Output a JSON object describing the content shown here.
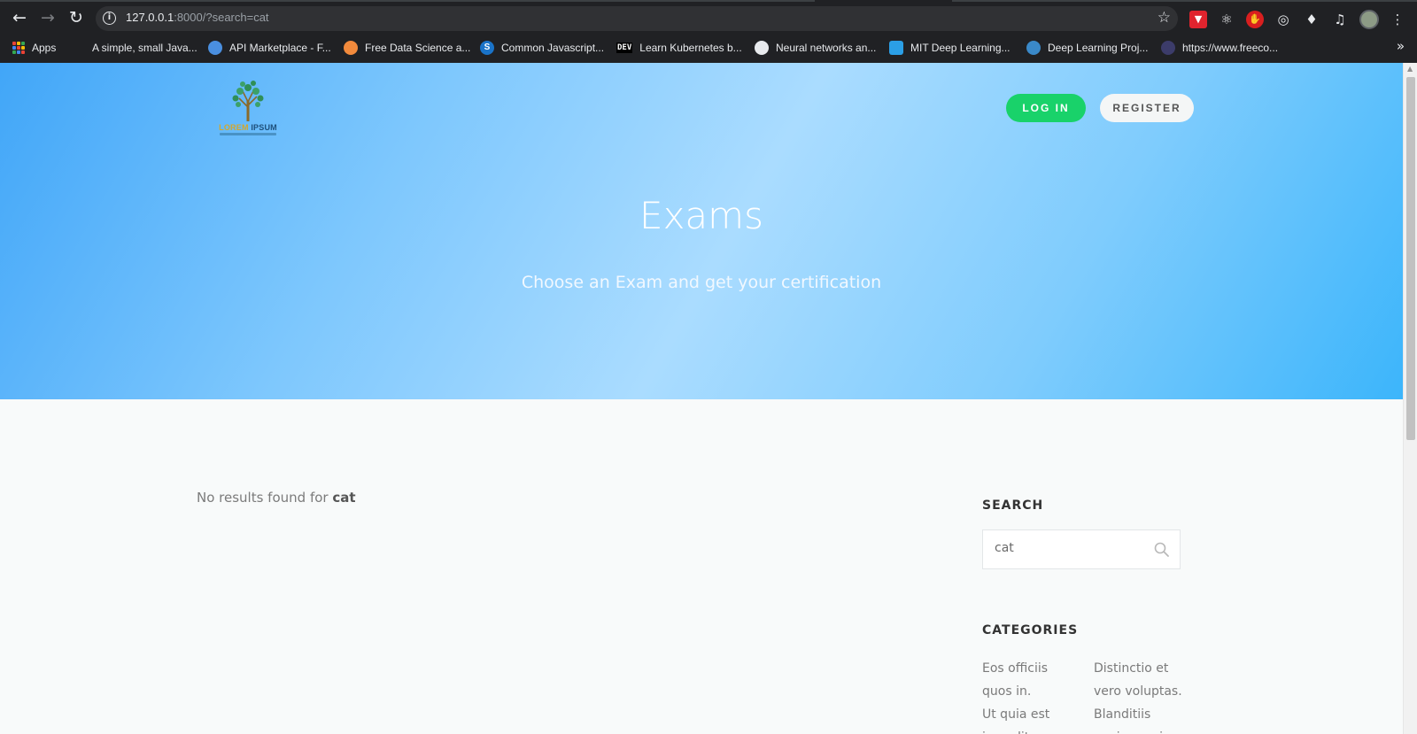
{
  "browser": {
    "url_host": "127.0.0.1",
    "url_rest": ":8000/?search=cat",
    "bookmarks": [
      {
        "label": "Apps"
      },
      {
        "label": "A simple, small Java..."
      },
      {
        "label": "API Marketplace - F..."
      },
      {
        "label": "Free Data Science a..."
      },
      {
        "label": "Common Javascript..."
      },
      {
        "label": "Learn Kubernetes b..."
      },
      {
        "label": "Neural networks an..."
      },
      {
        "label": "MIT Deep Learning..."
      },
      {
        "label": "Deep Learning Proj..."
      },
      {
        "label": "https://www.freeco..."
      }
    ],
    "bookmark_icon_texts": {
      "dev": "DEV",
      "s": "S"
    }
  },
  "logo": {
    "line1": "LOREM",
    "line2": "IPSUM"
  },
  "header": {
    "login_label": "LOG IN",
    "register_label": "REGISTER"
  },
  "hero": {
    "title": "Exams",
    "subtitle": "Choose an Exam and get your certification"
  },
  "results": {
    "prefix": "No results found for ",
    "query": "cat"
  },
  "sidebar": {
    "search_heading": "SEARCH",
    "search_value": "cat",
    "categories_heading": "CATEGORIES",
    "categories_col1": [
      "Eos officiis",
      "quos in.",
      "Ut quia est",
      "impedit"
    ],
    "categories_col2": [
      "Distinctio et",
      "vero voluptas.",
      "Blanditiis",
      "veniam qui"
    ]
  },
  "colors": {
    "login_bg": "#19d26a",
    "hero_gradient_start": "#41a6f8",
    "hero_gradient_end": "#3cb5fb"
  }
}
